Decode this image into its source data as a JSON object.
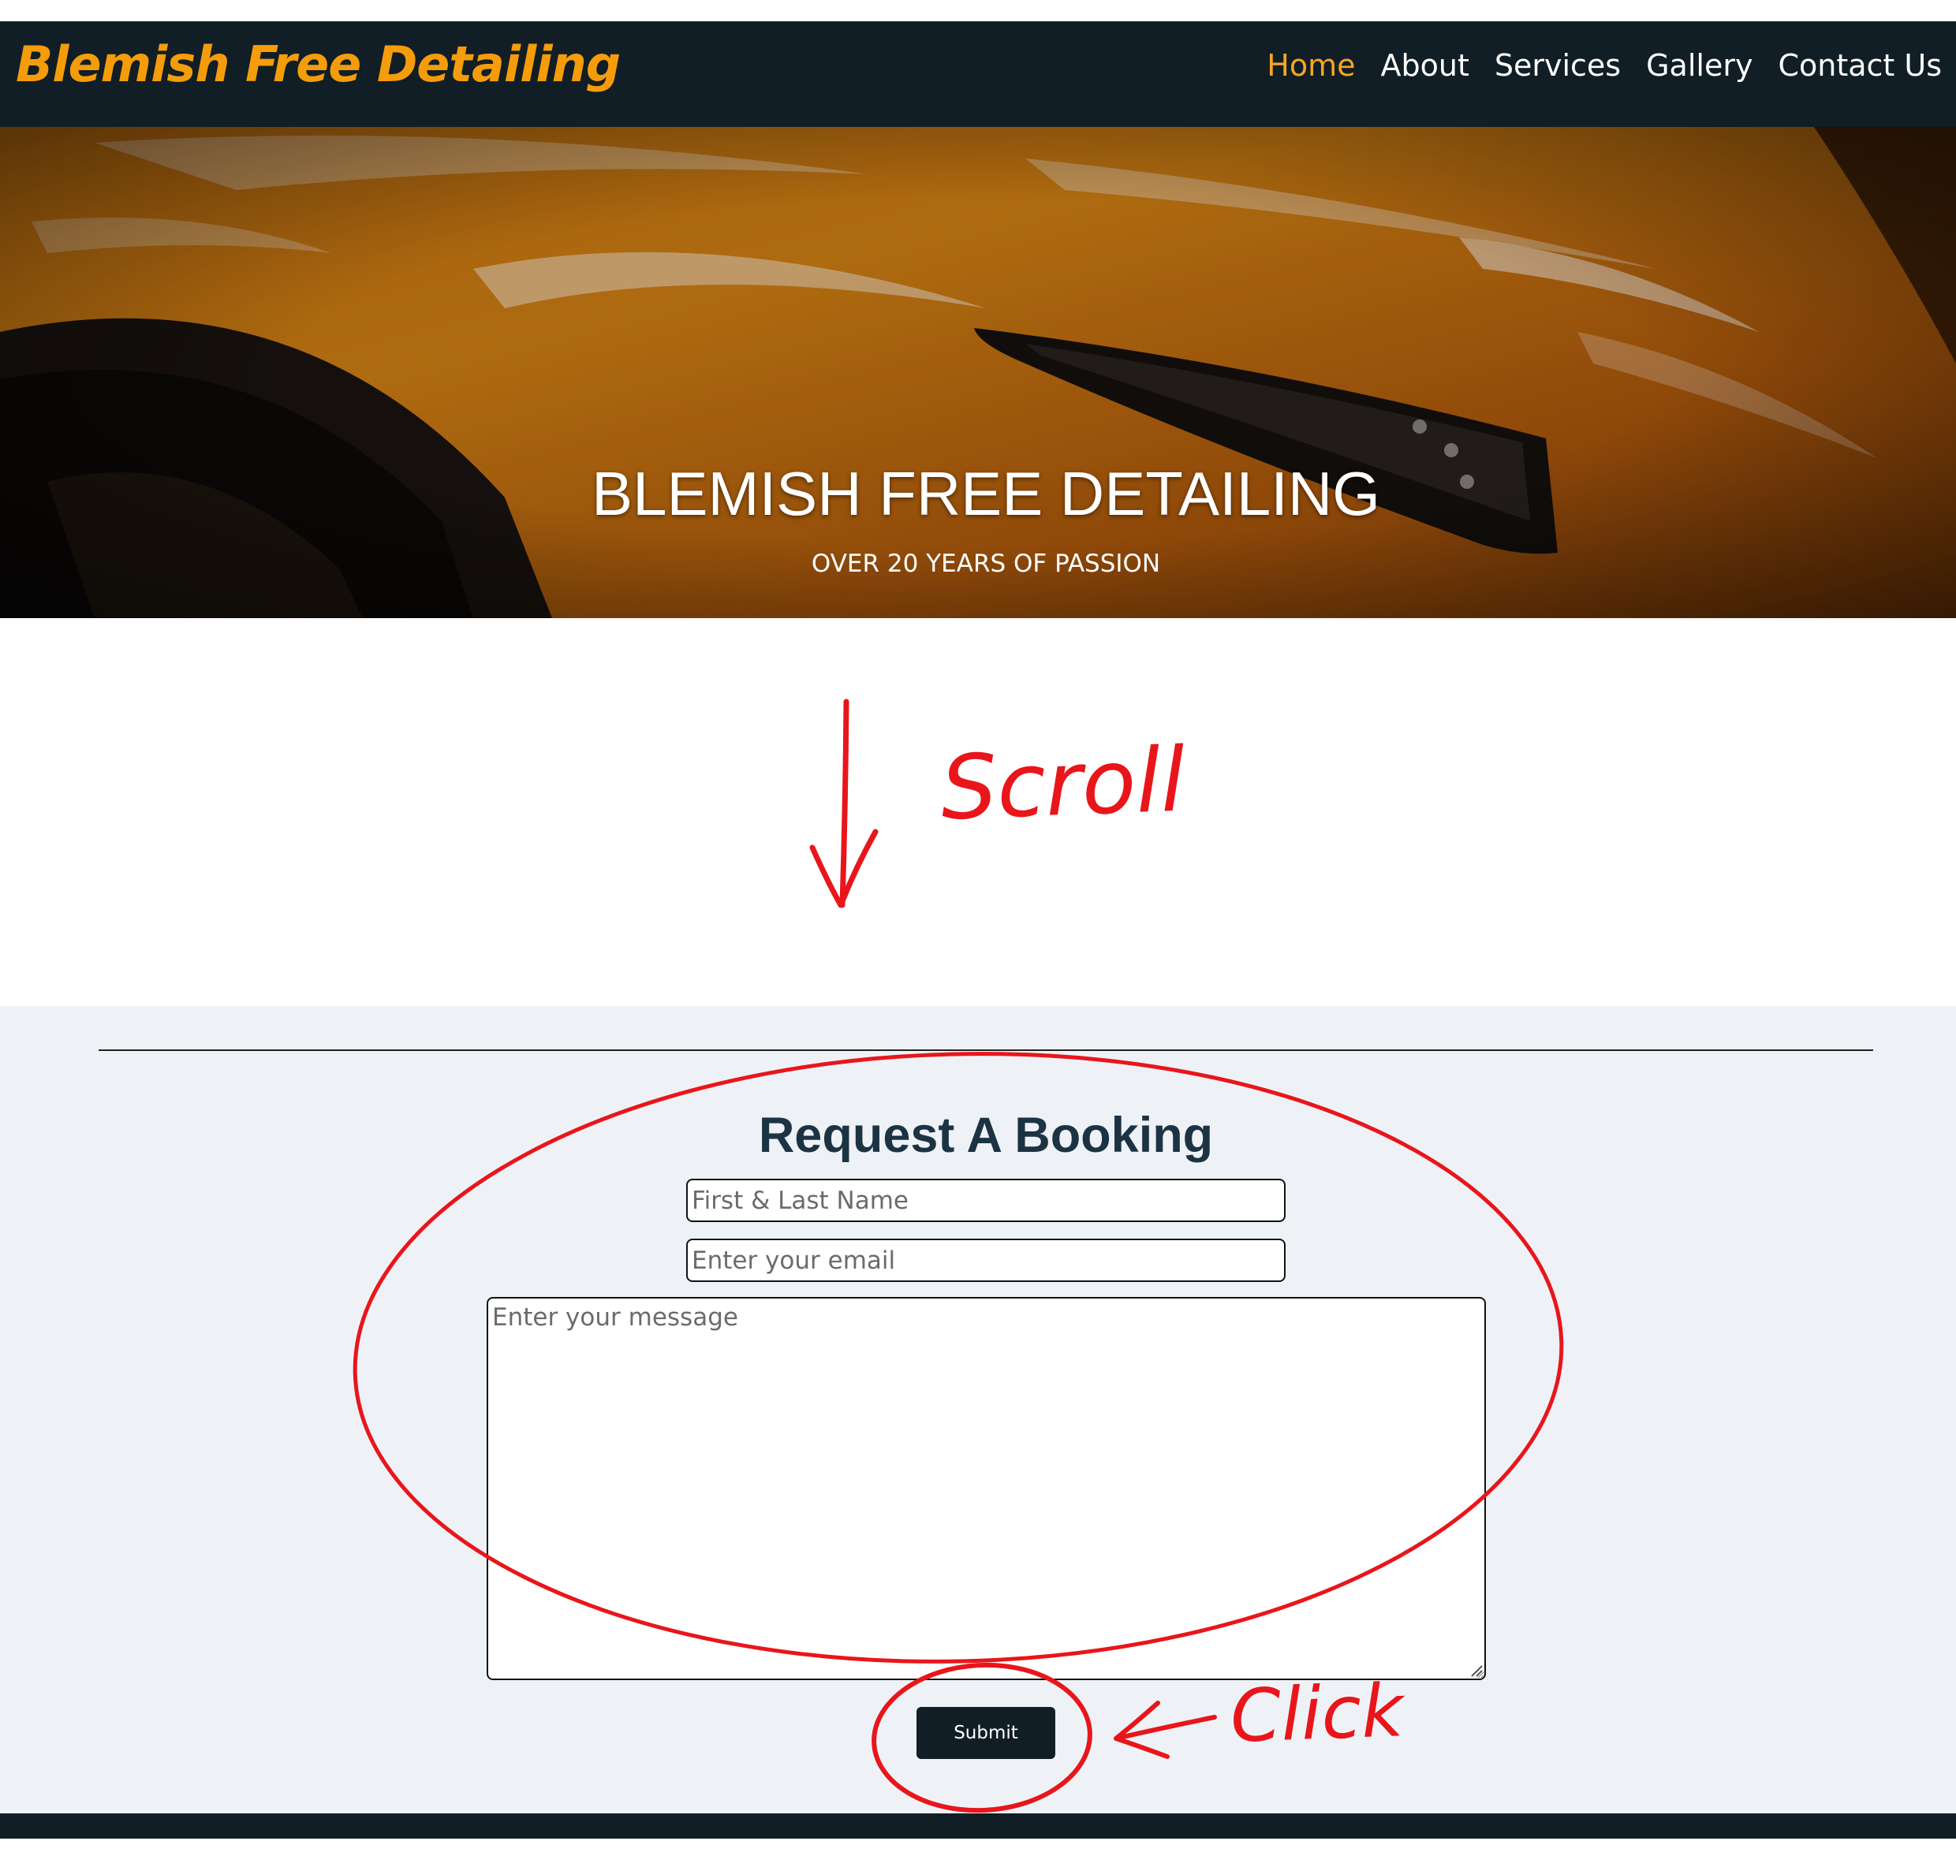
{
  "brand": {
    "name": "Blemish Free Detailing",
    "color": "#f59c0b"
  },
  "nav": {
    "items": [
      {
        "label": "Home",
        "active": true
      },
      {
        "label": "About",
        "active": false
      },
      {
        "label": "Services",
        "active": false
      },
      {
        "label": "Gallery",
        "active": false
      },
      {
        "label": "Contact Us",
        "active": false
      }
    ],
    "active_color": "#f5a623",
    "background": "#111e25"
  },
  "hero": {
    "title": "BLEMISH FREE DETAILING",
    "subtitle": "OVER 20 YEARS OF PASSION"
  },
  "annotations": {
    "scroll_label": "Scroll",
    "click_label": "Click",
    "color": "#e8161b"
  },
  "booking": {
    "title": "Request A Booking",
    "name_placeholder": "First & Last Name",
    "email_placeholder": "Enter your email",
    "message_placeholder": "Enter your message",
    "submit_label": "Submit",
    "background": "#eef2f7"
  }
}
